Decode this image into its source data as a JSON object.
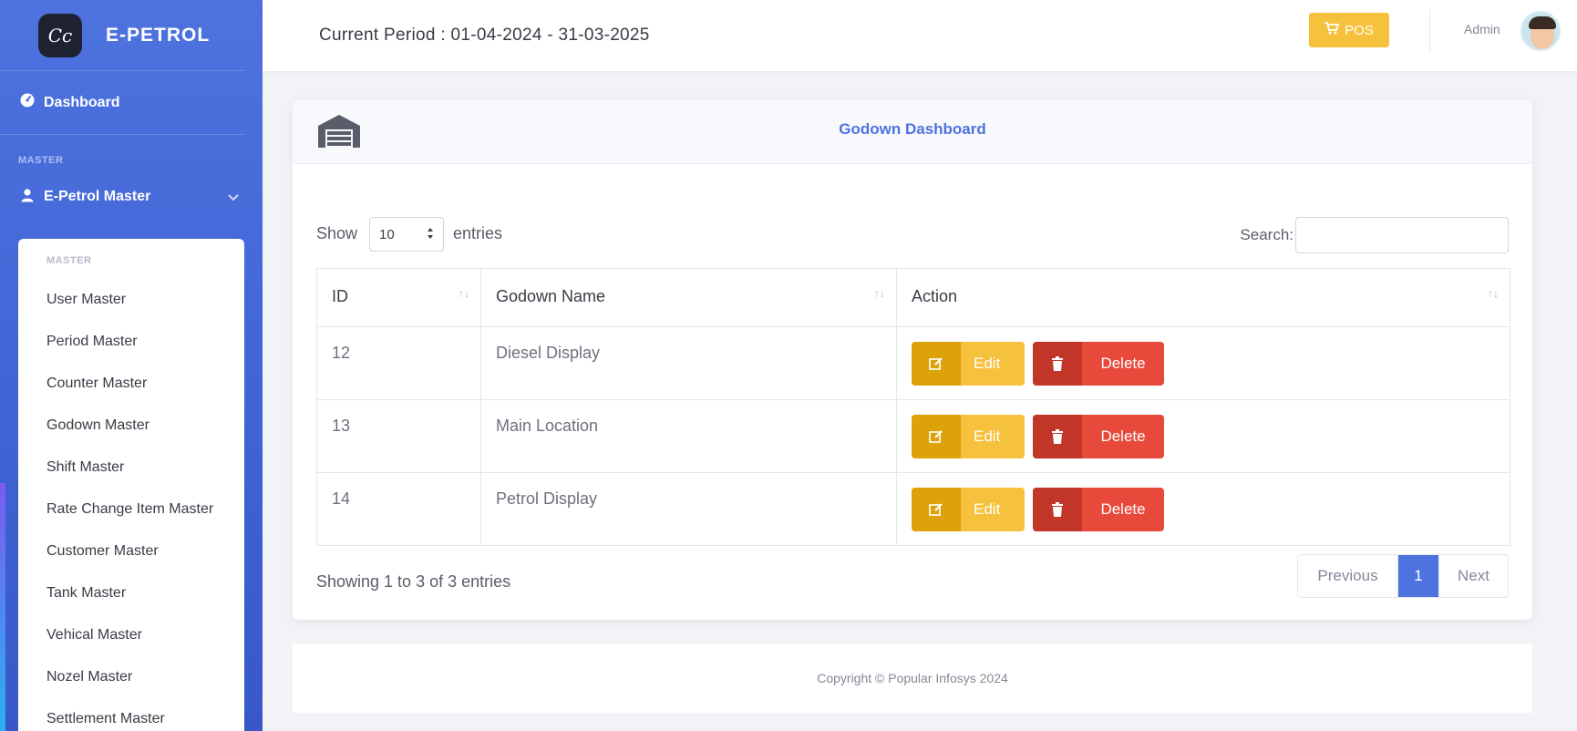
{
  "brand": {
    "logo_text": "Cc",
    "name": "E-PETROL"
  },
  "sidebar": {
    "dashboard_label": "Dashboard",
    "section_heading": "MASTER",
    "group_label": "E-Petrol Master",
    "submenu_heading": "MASTER",
    "items": [
      {
        "label": "User Master"
      },
      {
        "label": "Period Master"
      },
      {
        "label": "Counter Master"
      },
      {
        "label": "Godown Master"
      },
      {
        "label": "Shift Master"
      },
      {
        "label": "Rate Change Item Master"
      },
      {
        "label": "Customer Master"
      },
      {
        "label": "Tank Master"
      },
      {
        "label": "Vehical Master"
      },
      {
        "label": "Nozel Master"
      },
      {
        "label": "Settlement Master"
      }
    ]
  },
  "topbar": {
    "period_text": "Current Period : 01-04-2024 - 31-03-2025",
    "pos_label": "POS",
    "user_name": "Admin"
  },
  "card": {
    "title": "Godown Dashboard",
    "show_label": "Show",
    "page_length": "10",
    "entries_label": "entries",
    "search_label": "Search:",
    "search_value": "",
    "columns": [
      "ID",
      "Godown Name",
      "Action"
    ],
    "rows": [
      {
        "id": "12",
        "name": "Diesel Display"
      },
      {
        "id": "13",
        "name": "Main Location"
      },
      {
        "id": "14",
        "name": "Petrol Display"
      }
    ],
    "edit_label": "Edit",
    "delete_label": "Delete",
    "info_text": "Showing 1 to 3 of 3 entries",
    "pager": {
      "previous": "Previous",
      "current": "1",
      "next": "Next"
    }
  },
  "footer": {
    "text": "Copyright © Popular Infosys 2024"
  },
  "colors": {
    "primary": "#4e73df",
    "warning": "#f6c23e",
    "danger": "#e74a3b"
  },
  "icons": {
    "dashboard": "tachometer-icon",
    "group": "user-icon",
    "pos": "cart-icon",
    "header": "warehouse-icon",
    "edit": "edit-icon",
    "delete": "trash-icon"
  }
}
